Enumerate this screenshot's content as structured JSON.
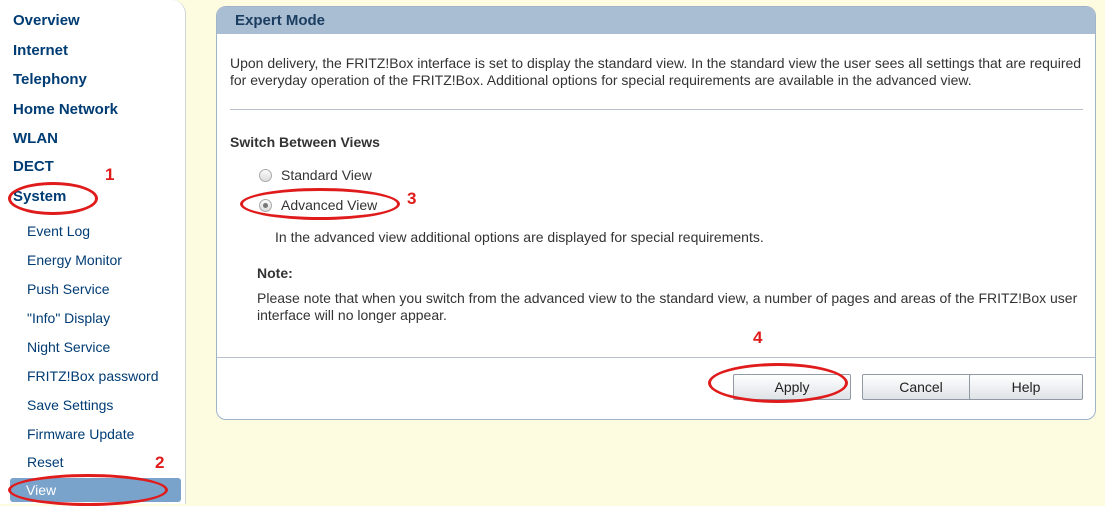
{
  "nav": {
    "main_items": [
      "Overview",
      "Internet",
      "Telephony",
      "Home Network",
      "WLAN",
      "DECT",
      "System"
    ],
    "sub_items": [
      "Event Log",
      "Energy Monitor",
      "Push Service",
      "\"Info\" Display",
      "Night Service",
      "FRITZ!Box password",
      "Save Settings",
      "Firmware Update",
      "Reset",
      "View"
    ],
    "active_sub": "View"
  },
  "panel": {
    "title": "Expert Mode",
    "description": "Upon delivery, the FRITZ!Box interface is set to display the standard view. In the standard view the user sees all settings that are required for everyday operation of the FRITZ!Box. Additional options for special requirements are available in the advanced view.",
    "section_title": "Switch Between Views",
    "options": [
      {
        "label": "Standard View",
        "selected": false
      },
      {
        "label": "Advanced View",
        "selected": true
      }
    ],
    "advanced_description": "In the advanced view additional options are displayed for special requirements.",
    "note_title": "Note:",
    "note_text": "Please note that when you switch from the advanced view to the standard view, a number of pages and areas of the FRITZ!Box user interface will no longer appear."
  },
  "buttons": {
    "apply": "Apply",
    "cancel": "Cancel",
    "help": "Help"
  },
  "annotations": [
    "1",
    "2",
    "3",
    "4"
  ],
  "colors": {
    "annotation": "#e01b1b",
    "nav_text": "#003c74",
    "header_bg": "#a9bdd3",
    "active_bg": "#7aa3cc",
    "page_bg": "#fdfbe0"
  }
}
